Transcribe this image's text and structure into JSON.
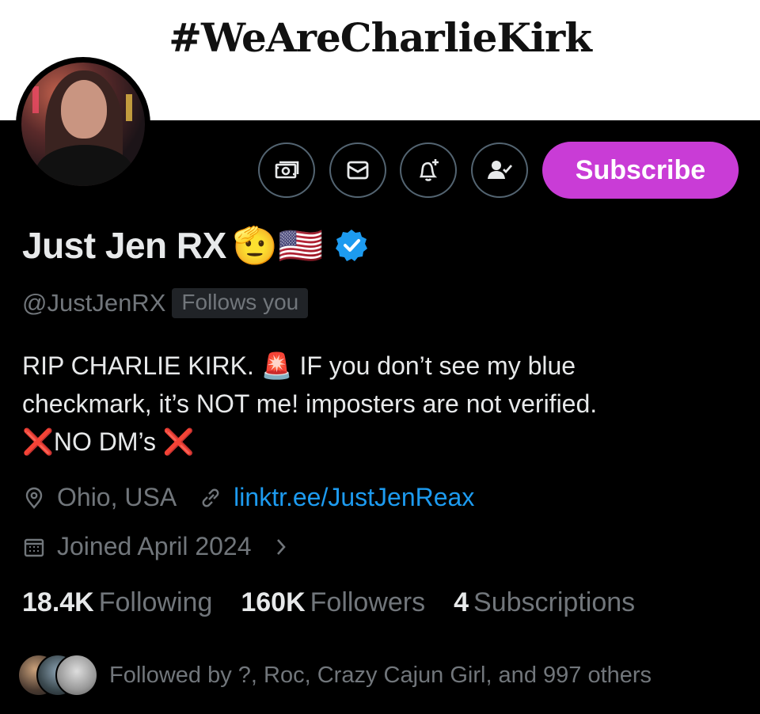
{
  "banner": {
    "text": "#WeAreCharlieKirk"
  },
  "profile": {
    "display_name": "Just Jen RX",
    "name_emojis": "🫡🇺🇸",
    "verified_icon": "verified-badge-icon",
    "handle": "@JustJenRX",
    "follows_you": "Follows you",
    "bio_line1": "RIP CHARLIE KIRK. 🚨 IF you don’t see my blue",
    "bio_line2": "checkmark, it’s NOT me! imposters are not verified.",
    "bio_line3": "❌NO DM’s ❌",
    "location": "Ohio, USA",
    "link": "linktr.ee/JustJenReax",
    "joined": "Joined April 2024"
  },
  "actions": {
    "tip_icon": "money-icon",
    "message_icon": "envelope-icon",
    "notify_icon": "bell-plus-icon",
    "following_icon": "person-check-icon",
    "subscribe_label": "Subscribe"
  },
  "stats": {
    "following_count": "18.4K",
    "following_label": "Following",
    "followers_count": "160K",
    "followers_label": "Followers",
    "subscriptions_count": "4",
    "subscriptions_label": "Subscriptions"
  },
  "followed_by": "Followed by ?, Roc, Crazy Cajun Girl, and 997 others",
  "colors": {
    "background": "#000000",
    "subscribe": "#c93cd6",
    "link": "#1d9bf0",
    "muted_text": "#71767b",
    "verified": "#1d9bf0"
  }
}
